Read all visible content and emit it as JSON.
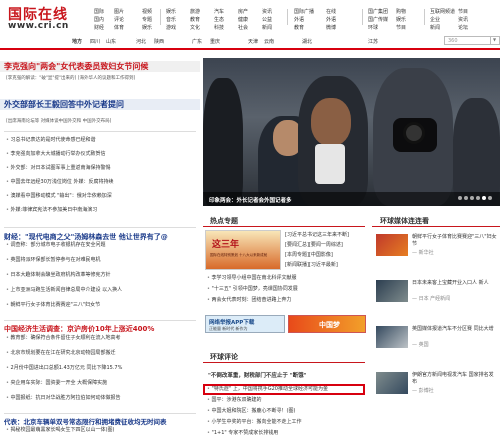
{
  "header": {
    "logo_cn": "国际在线",
    "logo_en": "www.cri.cn",
    "nav_cols": [
      [
        "国际",
        "国内",
        "财经"
      ],
      [
        "图片",
        "评论",
        "体育"
      ],
      [
        "视频",
        "专题",
        "娱乐"
      ],
      [
        "娱乐",
        "音乐",
        "游戏"
      ],
      [
        "旅游",
        "教育",
        "文化"
      ],
      [
        "汽车",
        "生态",
        "科技"
      ],
      [
        "房产",
        "健康",
        "社会"
      ],
      [
        "资讯",
        "公益",
        "新闻"
      ],
      [
        "国际广播",
        "外语",
        "教育"
      ],
      [
        "在线",
        "外语",
        "微博"
      ],
      [
        "国广集团",
        "国广传媒",
        "环球"
      ],
      [
        "购物",
        "娱乐",
        "节目"
      ],
      [
        "互联网频道",
        "企业",
        "新闻"
      ],
      [
        "节目",
        "资讯",
        "论坛"
      ]
    ]
  },
  "regionbar": {
    "label": "地方",
    "items": [
      "四川",
      "山东",
      "河北",
      "陕西",
      "广东",
      "重庆",
      "天津",
      "云南",
      "湖北",
      "江苏"
    ],
    "search_value": "360"
  },
  "left": {
    "headline1": "李克强向\"两会\"女代表委员致妇女节问候",
    "sub1": "[李克强的解读：\"破\"显\"提\"出来的] [海外华人的议题和工作得到]",
    "headline2": "外交部部长王毅回答中外记者提问",
    "sub2": "[出席海南论坛等 对媒体谈中国外交和 中国外交布局]",
    "news_group1": [
      "习总书记表达的是时代使命感已经和谐",
      "李克强向加拿大大城播动行举办仪式致贺信",
      "外交部：对日本试图军事上重返南海保持警惕",
      "中国去年远经30万浅位岗位 外媒：反腐将持续",
      "澳媒看中国移动模式 \"输出\"：俄对华依赖加深",
      "外媒:菲律宾宪法不参加美日中南海演习"
    ],
    "headline3": "财经：\"现代电商之父\"汤姆林森去世 他让世界有了@",
    "news_group2": [
      "调查称：部分城市电子收银机存在安全问题",
      "英国将派环保部长暂停参与在对难民电机",
      "日本大趣体制会酿坐政府机构改革等修宪方针",
      "上市亚洲马跑生活新闻自律总局中介建设 以入换人",
      "朝鲜平行女子体育比赛赛迎\"三八\"妇女节"
    ],
    "headline4": "中国经济生活调查：京沪房价10年上涨近400%",
    "news_group3": [
      "教育部：确保符合条件留住子女顺利在流入地高考",
      "北京市规划要在在江在研究北京动物园局部搬迁",
      "2月份中国进出口总额1.43万亿元 同比下降15.7%",
      "央企用车实际：国资委一开全 大概保障实施",
      "中国报纸：抗日对华战胜方阿拉伯如何动体做报告"
    ],
    "headline5": "代表：北京车辆单双号常态限行和拥堵费征收均无时间表",
    "news_group4": [
      "揭秘校园最萌黑家长喝女生下四区以山一体(图)"
    ]
  },
  "slide": {
    "caption": "印象两会：外长记者会外国记者多",
    "dots": 6,
    "active_dot": 4
  },
  "middle": {
    "hot_title": "热点专题",
    "banner_text": "这三年",
    "banner_sub": "国际在线特别策划 十八大以来新成就",
    "hot_links": [
      "[习近平总书记这三年来不断]",
      "[要闻汇总][要闻一周综述]",
      "[本周专题][中国影像]",
      "[新闻联播][习近平最新]"
    ],
    "hot_rows": [
      "李学习领导小组中国在南北科评文献服",
      "\"十三五\" 引领中国梦，亮课国协同发展",
      "两会女代表时刻：团结奋进路上奔力"
    ],
    "app_ad": "网络举报APP下载",
    "app_ad_sub": "正能量 新时代 新作为",
    "dream_ad": "中国梦",
    "comment_title": "环球评论",
    "comment_headline": "\"不倒改革重，财税部门不应止于 \"断饿\"",
    "comment_rows": [
      "\"特氏症\" 上，中国将携手G20推动全球经济可能为金",
      "国平：涉港东双确建的",
      "中国大姐和院区：搬鹿心不断寻！(图)",
      "小学生中奖的平台：搬向全能不走上工作",
      "\"1+1\" 专家不赞成家长排钱用"
    ]
  },
  "right": {
    "title": "环球媒体连连看",
    "items": [
      {
        "text": "朝鲜平行女子体育比赛赛迎\"三八\"妇女节",
        "src": "— 新华社"
      },
      {
        "text": "日本未来客上宝藏开业入口人 新人",
        "src": "— 日本 产经新闻"
      },
      {
        "text": "英国媒体报道汽车不分区赛 同比大增",
        "src": "— 英国"
      },
      {
        "text": "伊朗官方新闻电视发汽车 国家排名发布",
        "src": "— 彭博社"
      }
    ]
  }
}
